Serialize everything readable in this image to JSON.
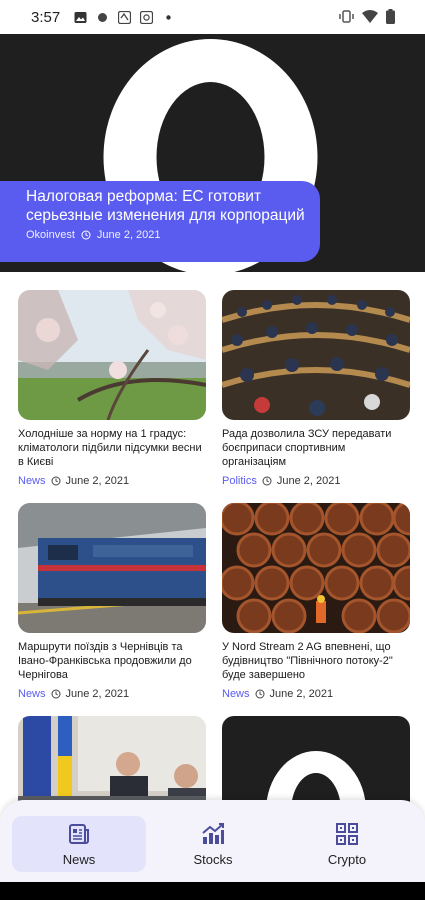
{
  "status": {
    "time": "3:57"
  },
  "hero": {
    "title": "Налоговая реформа: ЕС готовит серьезные изменения для корпораций",
    "source": "Okoinvest",
    "date": "June 2, 2021"
  },
  "articles": [
    {
      "title": "Холодніше за норму на 1 градус: кліматологи підбили підсумки весни в Києві",
      "category": "News",
      "date": "June 2, 2021"
    },
    {
      "title": "Рада дозволила ЗСУ передавати боєприпаси спортивним організаціям",
      "category": "Politics",
      "date": "June 2, 2021"
    },
    {
      "title": "Маршрути поїздів з Чернівців та Івано-Франківська продовжили до Чернігова",
      "category": "News",
      "date": "June 2, 2021"
    },
    {
      "title": "У Nord Stream 2 AG впевнені, що будівництво \"Північного потоку-2\" буде завершено",
      "category": "News",
      "date": "June 2, 2021"
    }
  ],
  "nav": {
    "items": [
      {
        "label": "News"
      },
      {
        "label": "Stocks"
      },
      {
        "label": "Crypto"
      }
    ],
    "active": "News"
  },
  "colors": {
    "accent": "#5a5cf0",
    "hero_bg": "#1f1f1f",
    "nav_bg": "#f4f3fb"
  }
}
